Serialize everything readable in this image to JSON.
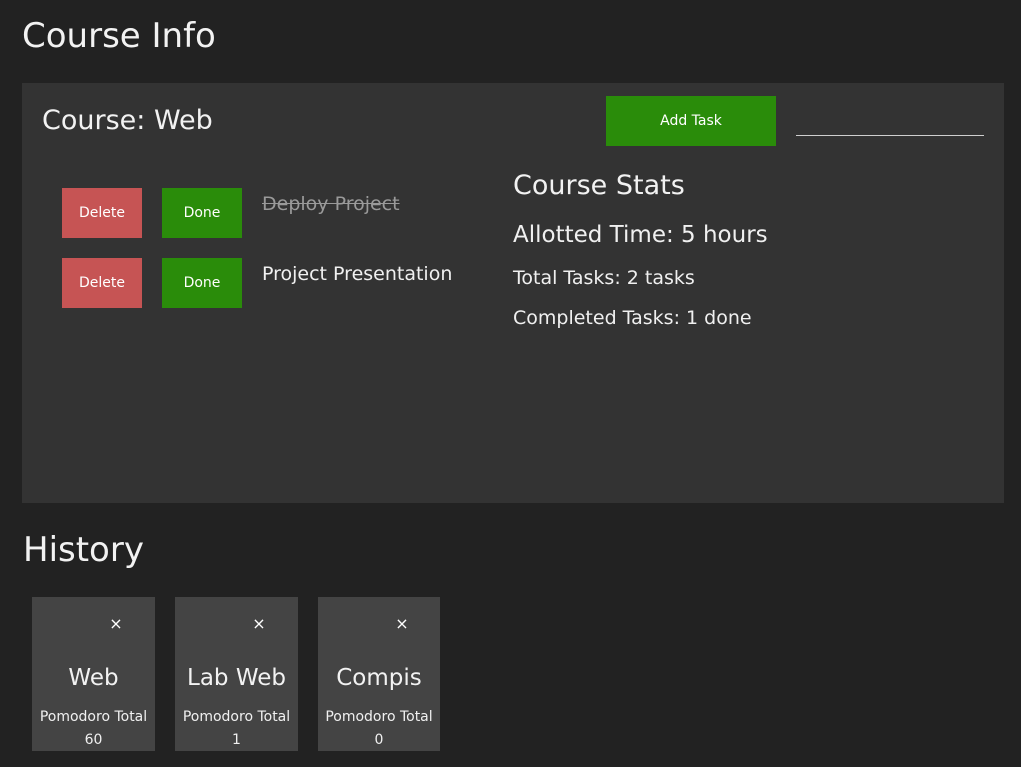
{
  "header": {
    "title": "Course Info"
  },
  "course": {
    "name": "Course: Web",
    "add_task_label": "Add Task",
    "task_input_value": "",
    "task_input_placeholder": "",
    "tasks": [
      {
        "delete_label": "Delete",
        "done_label": "Done",
        "name": "Deploy Project",
        "completed": true
      },
      {
        "delete_label": "Delete",
        "done_label": "Done",
        "name": "Project Presentation",
        "completed": false
      }
    ]
  },
  "stats": {
    "title": "Course Stats",
    "allotted": "Allotted Time: 5 hours",
    "total": "Total Tasks: 2 tasks",
    "completed": "Completed Tasks: 1 done"
  },
  "history": {
    "title": "History",
    "cards": [
      {
        "close": "×",
        "name": "Web",
        "total_label": "Pomodoro Total",
        "total_value": "60"
      },
      {
        "close": "×",
        "name": "Lab Web",
        "total_label": "Pomodoro Total",
        "total_value": "1"
      },
      {
        "close": "×",
        "name": "Compis",
        "total_label": "Pomodoro Total",
        "total_value": "0"
      }
    ]
  },
  "colors": {
    "background": "#222222",
    "panel": "#333333",
    "card": "#444444",
    "done_green": "#2a8c0a",
    "delete_red": "#c65454"
  }
}
